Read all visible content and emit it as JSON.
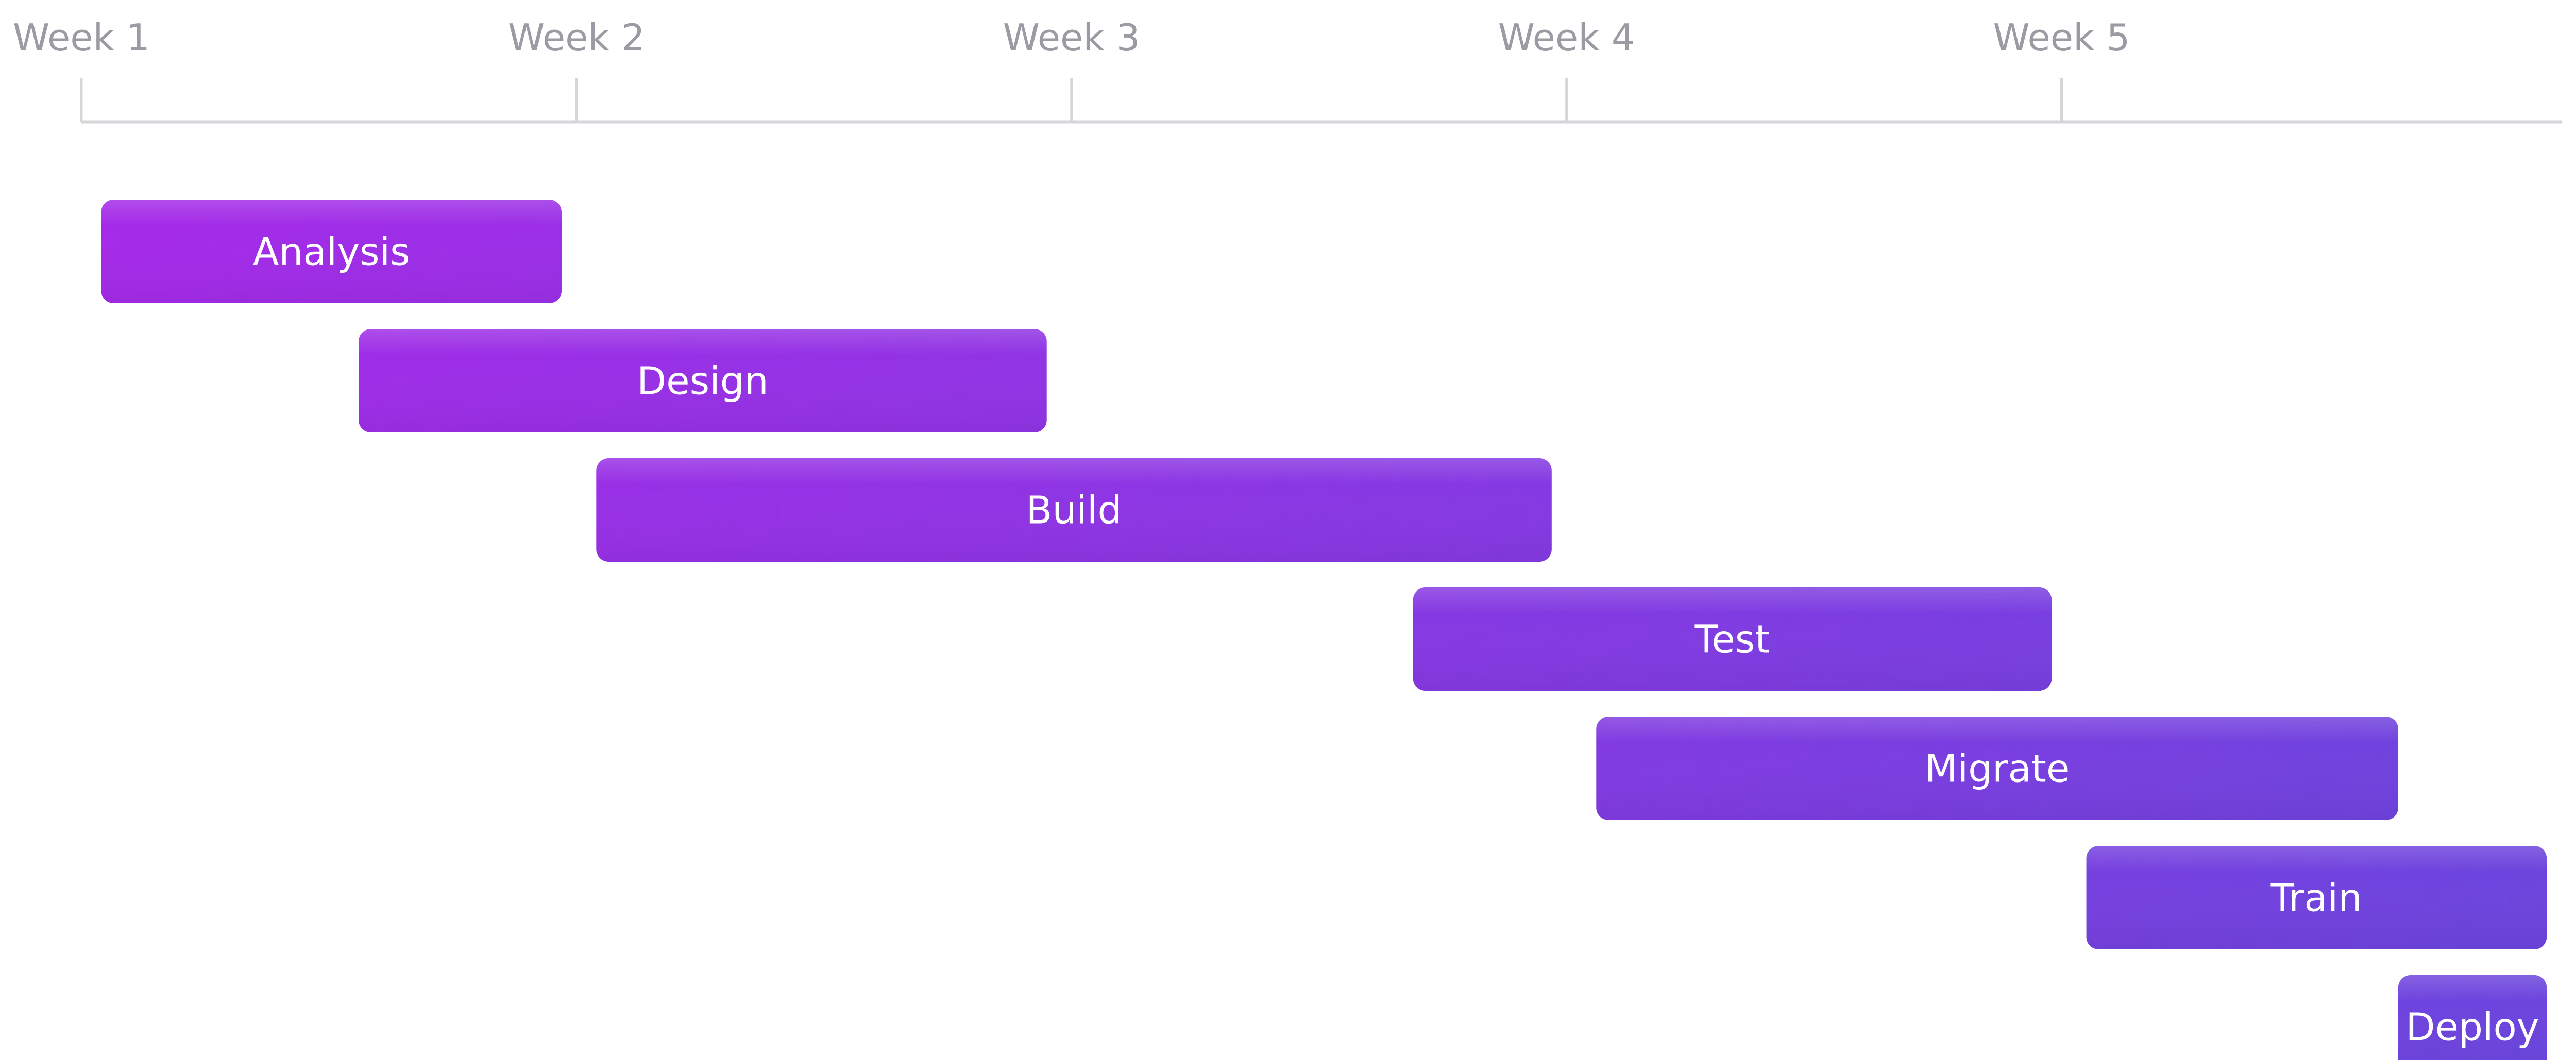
{
  "chart_data": {
    "type": "gantt",
    "x_axis": {
      "unit": "week",
      "min": 1,
      "max": 6.01,
      "tick_values": [
        1,
        2,
        3,
        4,
        5
      ],
      "tick_labels": [
        "Week 1",
        "Week 2",
        "Week 3",
        "Week 4",
        "Week 5"
      ]
    },
    "tasks": [
      {
        "name": "Analysis",
        "start": 1.04,
        "end": 1.97
      },
      {
        "name": "Design",
        "start": 1.56,
        "end": 2.95
      },
      {
        "name": "Build",
        "start": 2.04,
        "end": 3.97
      },
      {
        "name": "Test",
        "start": 3.69,
        "end": 4.98
      },
      {
        "name": "Migrate",
        "start": 4.06,
        "end": 5.68
      },
      {
        "name": "Train",
        "start": 5.05,
        "end": 5.98
      },
      {
        "name": "Deploy",
        "start": 5.68,
        "end": 5.98
      }
    ],
    "grid": false,
    "legend": "none",
    "colors": {
      "bar_start": "#a52ae8",
      "bar_end": "#6b45dd",
      "axis": "#d6d6da",
      "tick_text": "#9a9ba3",
      "bar_text": "#ffffff"
    }
  }
}
